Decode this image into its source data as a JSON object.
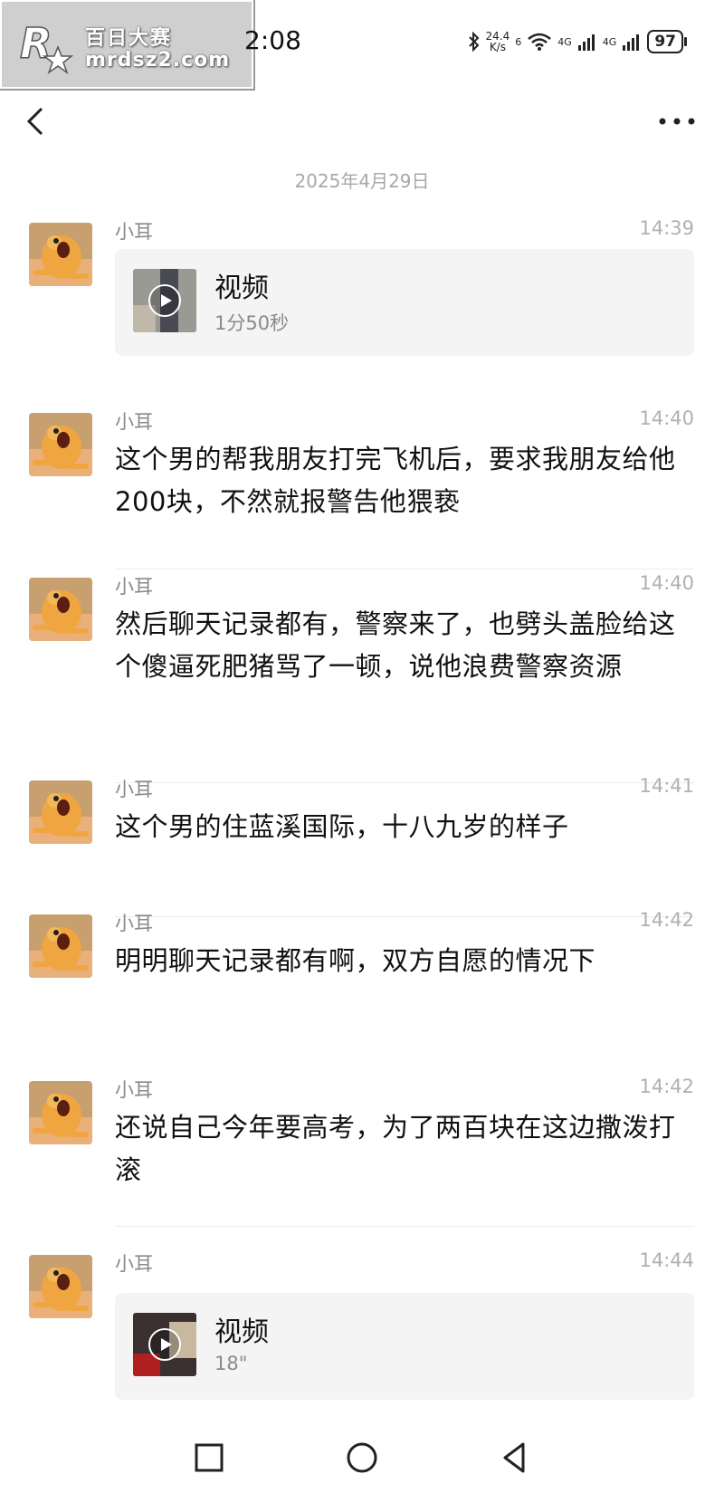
{
  "status_bar": {
    "watermark_line1": "百日大赛",
    "watermark_line2": "mrdsz2.com",
    "time": "2:08",
    "net_speed_value": "24.4",
    "net_speed_unit": "K/s",
    "wifi_label": "6",
    "sim1_label": "4G",
    "sim2_label": "4G",
    "battery": "97"
  },
  "header": {
    "back_icon": "chevron-left-icon",
    "more_icon": "more-horizontal-icon"
  },
  "date_separator": "2025年4月29日",
  "messages": [
    {
      "type": "video",
      "sender": "小耳",
      "time": "14:39",
      "video_title": "视频",
      "duration": "1分50秒"
    },
    {
      "type": "text",
      "sender": "小耳",
      "time": "14:40",
      "text": "这个男的帮我朋友打完飞机后，要求我朋友给他200块，不然就报警告他猥亵"
    },
    {
      "type": "text",
      "sender": "小耳",
      "time": "14:40",
      "text": "然后聊天记录都有，警察来了，也劈头盖脸给这个傻逼死肥猪骂了一顿，说他浪费警察资源"
    },
    {
      "type": "text",
      "sender": "小耳",
      "time": "14:41",
      "text": "这个男的住蓝溪国际，十八九岁的样子"
    },
    {
      "type": "text",
      "sender": "小耳",
      "time": "14:42",
      "text": "明明聊天记录都有啊，双方自愿的情况下"
    },
    {
      "type": "text",
      "sender": "小耳",
      "time": "14:42",
      "text": "还说自己今年要高考，为了两百块在这边撒泼打滚"
    },
    {
      "type": "video",
      "sender": "小耳",
      "time": "14:44",
      "video_title": "视频",
      "duration": "18\""
    }
  ],
  "system_nav": {
    "recent_icon": "square-icon",
    "home_icon": "circle-icon",
    "back_icon": "triangle-back-icon"
  },
  "colors": {
    "background": "#ffffff",
    "video_card": "#f4f4f4",
    "avatar_bg": "#f0a640",
    "secondary_text": "#8a8a8a"
  }
}
